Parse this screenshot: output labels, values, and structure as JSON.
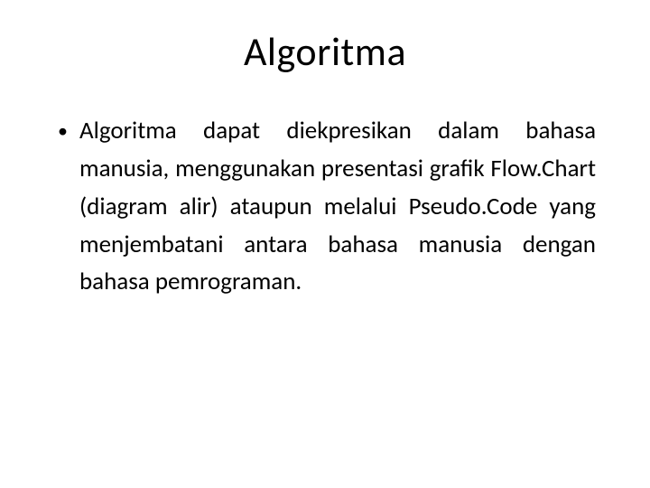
{
  "slide": {
    "title": "Algoritma",
    "bullets": [
      "Algoritma dapat diekpresikan dalam bahasa manusia, menggunakan presentasi grafik Flow.Chart (diagram alir) ataupun melalui Pseudo.Code yang menjembatani antara bahasa manusia dengan bahasa pemrograman."
    ]
  }
}
